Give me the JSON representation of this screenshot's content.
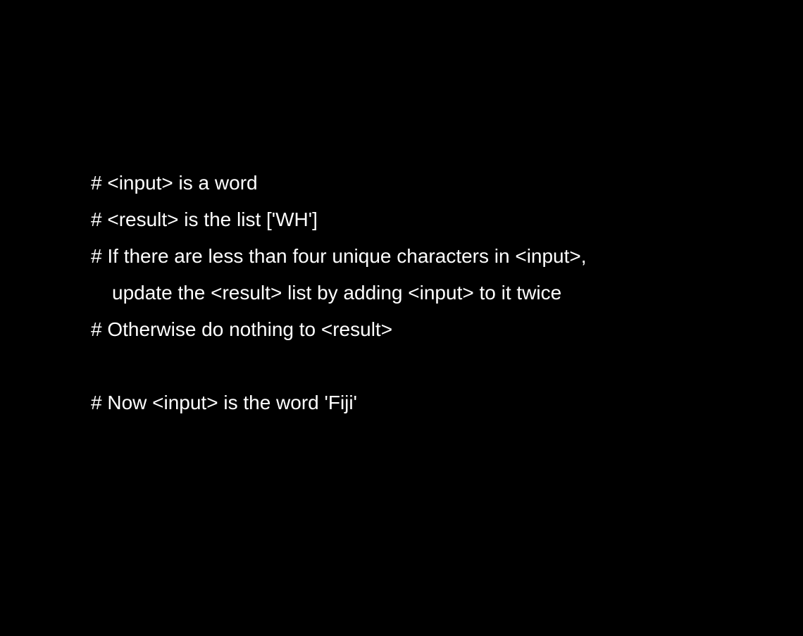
{
  "colors": {
    "background": "#000000",
    "text": "#ffffff"
  },
  "lines": [
    "# <input> is a word",
    "# <result> is the list ['WH']",
    "# If there are less than four unique characters in <input>,",
    "update the <result> list by adding <input> to it twice",
    "# Otherwise do nothing to <result>",
    "",
    "# Now <input> is the word 'Fiji'"
  ]
}
